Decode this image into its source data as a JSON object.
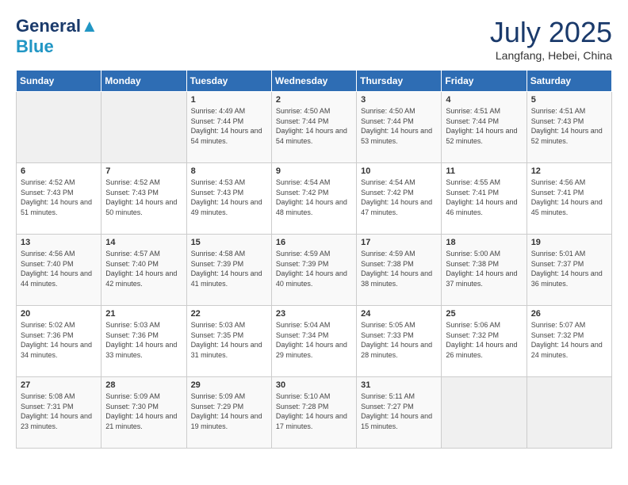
{
  "header": {
    "logo_line1": "General",
    "logo_line2": "Blue",
    "month_year": "July 2025",
    "location": "Langfang, Hebei, China"
  },
  "days_of_week": [
    "Sunday",
    "Monday",
    "Tuesday",
    "Wednesday",
    "Thursday",
    "Friday",
    "Saturday"
  ],
  "weeks": [
    [
      {
        "day": "",
        "empty": true
      },
      {
        "day": "",
        "empty": true
      },
      {
        "day": "1",
        "sunrise": "4:49 AM",
        "sunset": "7:44 PM",
        "daylight": "14 hours and 54 minutes."
      },
      {
        "day": "2",
        "sunrise": "4:50 AM",
        "sunset": "7:44 PM",
        "daylight": "14 hours and 54 minutes."
      },
      {
        "day": "3",
        "sunrise": "4:50 AM",
        "sunset": "7:44 PM",
        "daylight": "14 hours and 53 minutes."
      },
      {
        "day": "4",
        "sunrise": "4:51 AM",
        "sunset": "7:44 PM",
        "daylight": "14 hours and 52 minutes."
      },
      {
        "day": "5",
        "sunrise": "4:51 AM",
        "sunset": "7:43 PM",
        "daylight": "14 hours and 52 minutes."
      }
    ],
    [
      {
        "day": "6",
        "sunrise": "4:52 AM",
        "sunset": "7:43 PM",
        "daylight": "14 hours and 51 minutes."
      },
      {
        "day": "7",
        "sunrise": "4:52 AM",
        "sunset": "7:43 PM",
        "daylight": "14 hours and 50 minutes."
      },
      {
        "day": "8",
        "sunrise": "4:53 AM",
        "sunset": "7:43 PM",
        "daylight": "14 hours and 49 minutes."
      },
      {
        "day": "9",
        "sunrise": "4:54 AM",
        "sunset": "7:42 PM",
        "daylight": "14 hours and 48 minutes."
      },
      {
        "day": "10",
        "sunrise": "4:54 AM",
        "sunset": "7:42 PM",
        "daylight": "14 hours and 47 minutes."
      },
      {
        "day": "11",
        "sunrise": "4:55 AM",
        "sunset": "7:41 PM",
        "daylight": "14 hours and 46 minutes."
      },
      {
        "day": "12",
        "sunrise": "4:56 AM",
        "sunset": "7:41 PM",
        "daylight": "14 hours and 45 minutes."
      }
    ],
    [
      {
        "day": "13",
        "sunrise": "4:56 AM",
        "sunset": "7:40 PM",
        "daylight": "14 hours and 44 minutes."
      },
      {
        "day": "14",
        "sunrise": "4:57 AM",
        "sunset": "7:40 PM",
        "daylight": "14 hours and 42 minutes."
      },
      {
        "day": "15",
        "sunrise": "4:58 AM",
        "sunset": "7:39 PM",
        "daylight": "14 hours and 41 minutes."
      },
      {
        "day": "16",
        "sunrise": "4:59 AM",
        "sunset": "7:39 PM",
        "daylight": "14 hours and 40 minutes."
      },
      {
        "day": "17",
        "sunrise": "4:59 AM",
        "sunset": "7:38 PM",
        "daylight": "14 hours and 38 minutes."
      },
      {
        "day": "18",
        "sunrise": "5:00 AM",
        "sunset": "7:38 PM",
        "daylight": "14 hours and 37 minutes."
      },
      {
        "day": "19",
        "sunrise": "5:01 AM",
        "sunset": "7:37 PM",
        "daylight": "14 hours and 36 minutes."
      }
    ],
    [
      {
        "day": "20",
        "sunrise": "5:02 AM",
        "sunset": "7:36 PM",
        "daylight": "14 hours and 34 minutes."
      },
      {
        "day": "21",
        "sunrise": "5:03 AM",
        "sunset": "7:36 PM",
        "daylight": "14 hours and 33 minutes."
      },
      {
        "day": "22",
        "sunrise": "5:03 AM",
        "sunset": "7:35 PM",
        "daylight": "14 hours and 31 minutes."
      },
      {
        "day": "23",
        "sunrise": "5:04 AM",
        "sunset": "7:34 PM",
        "daylight": "14 hours and 29 minutes."
      },
      {
        "day": "24",
        "sunrise": "5:05 AM",
        "sunset": "7:33 PM",
        "daylight": "14 hours and 28 minutes."
      },
      {
        "day": "25",
        "sunrise": "5:06 AM",
        "sunset": "7:32 PM",
        "daylight": "14 hours and 26 minutes."
      },
      {
        "day": "26",
        "sunrise": "5:07 AM",
        "sunset": "7:32 PM",
        "daylight": "14 hours and 24 minutes."
      }
    ],
    [
      {
        "day": "27",
        "sunrise": "5:08 AM",
        "sunset": "7:31 PM",
        "daylight": "14 hours and 23 minutes."
      },
      {
        "day": "28",
        "sunrise": "5:09 AM",
        "sunset": "7:30 PM",
        "daylight": "14 hours and 21 minutes."
      },
      {
        "day": "29",
        "sunrise": "5:09 AM",
        "sunset": "7:29 PM",
        "daylight": "14 hours and 19 minutes."
      },
      {
        "day": "30",
        "sunrise": "5:10 AM",
        "sunset": "7:28 PM",
        "daylight": "14 hours and 17 minutes."
      },
      {
        "day": "31",
        "sunrise": "5:11 AM",
        "sunset": "7:27 PM",
        "daylight": "14 hours and 15 minutes."
      },
      {
        "day": "",
        "empty": true
      },
      {
        "day": "",
        "empty": true
      }
    ]
  ],
  "labels": {
    "sunrise_prefix": "Sunrise: ",
    "sunset_prefix": "Sunset: ",
    "daylight_prefix": "Daylight: "
  }
}
